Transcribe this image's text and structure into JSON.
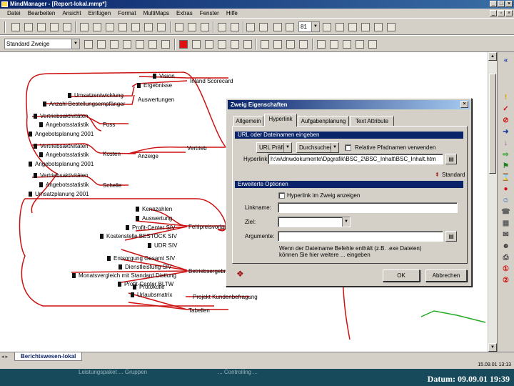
{
  "window": {
    "title": "MindManager - [Report-lokal.mmp*]"
  },
  "menu": [
    "Datei",
    "Bearbeiten",
    "Ansicht",
    "Einfügen",
    "Format",
    "MultiMaps",
    "Extras",
    "Fenster",
    "Hilfe"
  ],
  "toolbar": {
    "zoom_value": "81",
    "branch_style": "Standard Zweige"
  },
  "map": {
    "topics": [
      {
        "label": "Inland Scorecard"
      },
      {
        "label": "Auswertungen"
      },
      {
        "label": "Fuss"
      },
      {
        "label": "Kosten"
      },
      {
        "label": "Anzeige"
      },
      {
        "label": "Vertrieb"
      },
      {
        "label": "Schelle"
      },
      {
        "label": "Fehlpreisvorlage"
      },
      {
        "label": "Betriebsergebnis"
      },
      {
        "label": "Projekt Kundenbefragung"
      },
      {
        "label": "Tabellen"
      }
    ],
    "nodes": [
      {
        "label": "Vision"
      },
      {
        "label": "Ergebnisse"
      },
      {
        "label": "Umsatzentwicklung"
      },
      {
        "label": "Anzahl Bestellungsempfänger"
      },
      {
        "label": "Vertriebsaktivitäten"
      },
      {
        "label": "Angebotsstatistik"
      },
      {
        "label": "Angebotsplanung 2001"
      },
      {
        "label": "Vertriebsaktivitäten"
      },
      {
        "label": "Angebotsstatistik"
      },
      {
        "label": "Angebotsplanung 2001"
      },
      {
        "label": "Vertriebsaktivitäten"
      },
      {
        "label": "Angebotsstatistik"
      },
      {
        "label": "Umsatzplanung 2001"
      },
      {
        "label": "Kennzahlen"
      },
      {
        "label": "Auswertung"
      },
      {
        "label": "Profit-Center SIV"
      },
      {
        "label": "Kostenstelle BESTOCK SIV"
      },
      {
        "label": "UDR SIV"
      },
      {
        "label": "Entsorgung Gesamt SIV"
      },
      {
        "label": "Dienstleistung SIV"
      },
      {
        "label": "Monatsvergleich mit Standard Distlung"
      },
      {
        "label": "Profit-Center BLTW"
      },
      {
        "label": "Protokolle"
      },
      {
        "label": "Urlaubsmatrix"
      }
    ]
  },
  "dialog": {
    "title": "Zweig Eigenschaften",
    "tabs": [
      "Allgemein",
      "Hyperlink",
      "Aufgabenplanung",
      "Text Attribute"
    ],
    "section1": "URL oder Dateinamen eingeben",
    "url_prefix": "URL Präfix",
    "browse_label": "Durchsuchen",
    "relative_label": "Relative Pfadnamen verwenden",
    "hyperlink_label": "Hyperlink:",
    "hyperlink_value": "h:\\w\\dnwdokumente\\Dpgrafik\\BSC_2\\BSC_Inhalt\\BSC_Inhalt.htm",
    "standard_label": "Standard",
    "section2": "Erweiterte Optionen",
    "open_in_branch": "Hyperlink im Zweig anzeigen",
    "linkname_label": "Linkname:",
    "target_label": "Ziel:",
    "arguments_label": "Argumente:",
    "hint_line1": "Wenn der Dateiname Befehle enthält (z.B. .exe Dateien)",
    "hint_line2": "können Sie hier weitere ... eingeben",
    "ok": "OK",
    "cancel": "Abbrechen"
  },
  "sheet_tab": "Berichtswesen-lokal",
  "status": {
    "time": "15.09.01 13:13"
  },
  "footer": {
    "ghost_left": "Leistungspaket ... Gruppen",
    "ghost_mid": "... Controlling ...",
    "date": "Datum: 09.09.01 19:39"
  },
  "colors": {
    "branch": "#cc1111",
    "dialog_title": "#0a246a",
    "footer_bg": "#174a5a"
  }
}
